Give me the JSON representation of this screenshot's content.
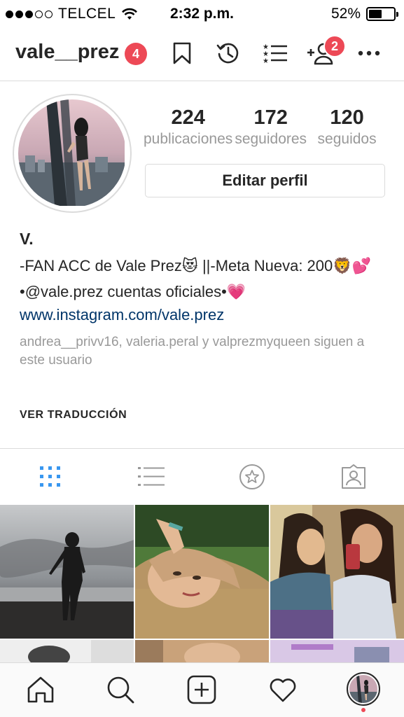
{
  "status_bar": {
    "carrier": "TELCEL",
    "time": "2:32 p.m.",
    "battery_percent": "52%",
    "battery_level": 0.52,
    "signal_bars": 3,
    "signal_total": 5
  },
  "header": {
    "username": "vale__prez",
    "account_badge": "4",
    "follow_requests_badge": "2",
    "icons": [
      "bookmark-icon",
      "history-icon",
      "list-icon",
      "add-user-icon",
      "more-icon"
    ]
  },
  "profile": {
    "posts_count": "224",
    "posts_label": "publicaciones",
    "followers_count": "172",
    "followers_label": "seguidores",
    "following_count": "120",
    "following_label": "seguidos",
    "edit_button": "Editar perfil"
  },
  "bio": {
    "name": "V.",
    "line1": "-FAN ACC de Vale Prez😻 ||-Meta Nueva: 200🦁💕",
    "line2": "•@vale.prez cuentas oficiales•💗",
    "link": "www.instagram.com/vale.prez",
    "followed_by": "andrea__privv16, valeria.peral y valprezmyqueen siguen a este usuario",
    "translate": "VER TRADUCCIÓN"
  },
  "tabs": [
    {
      "name": "grid",
      "active": true
    },
    {
      "name": "list",
      "active": false
    },
    {
      "name": "saved",
      "active": false
    },
    {
      "name": "tagged",
      "active": false
    }
  ],
  "colors": {
    "accent_blue": "#3897f0",
    "badge_red": "#ed4956",
    "link_blue": "#003569",
    "muted_gray": "#999999",
    "border": "#dbdbdb"
  },
  "bottom_nav": [
    "home-icon",
    "search-icon",
    "new-post-icon",
    "activity-heart-icon",
    "profile-avatar"
  ]
}
